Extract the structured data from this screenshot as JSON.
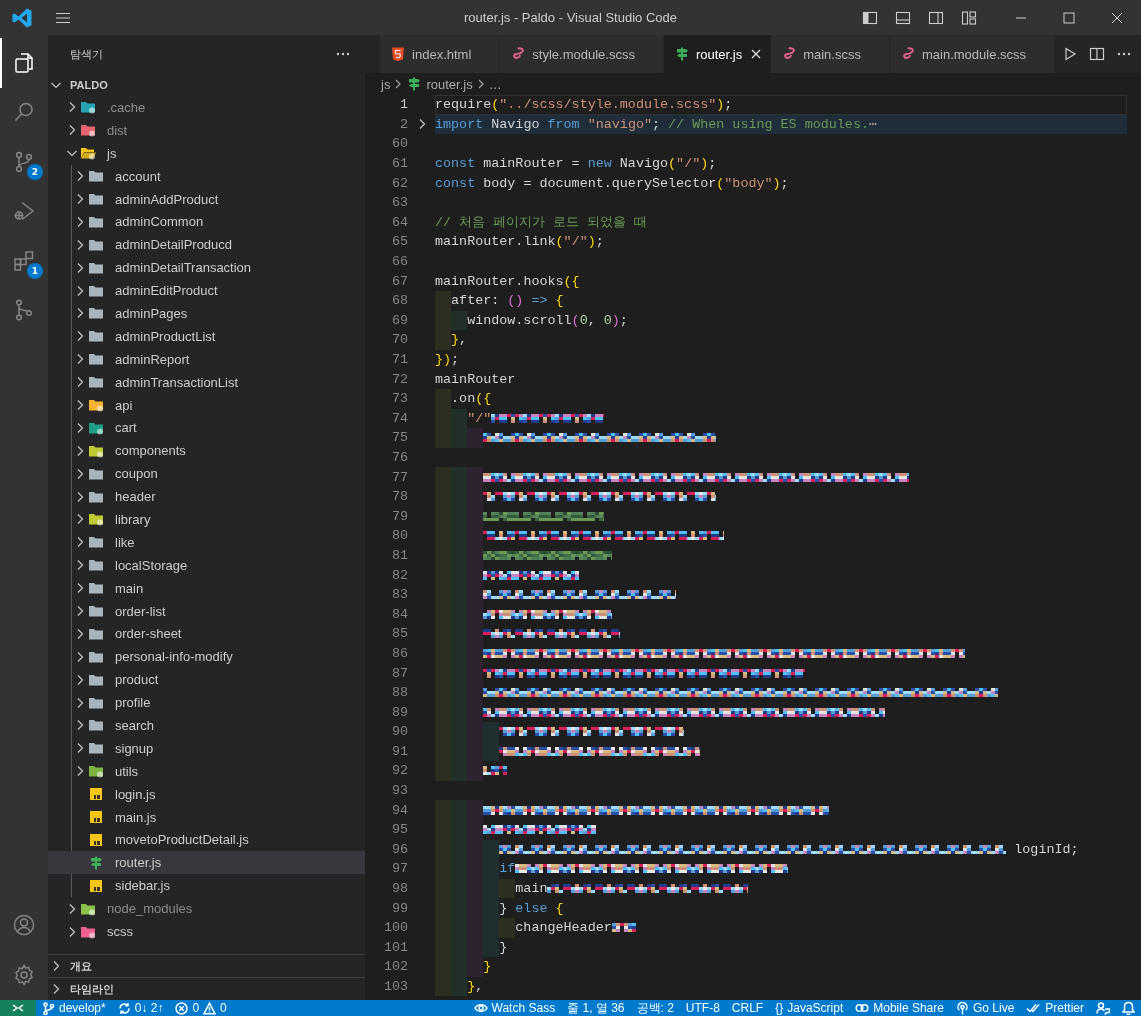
{
  "window": {
    "title": "router.js - Paldo - Visual Studio Code"
  },
  "activity_bar": {
    "items": [
      {
        "kind": "explorer",
        "selected": true
      },
      {
        "kind": "search",
        "selected": false
      },
      {
        "kind": "source-control",
        "selected": false,
        "badge": "2"
      },
      {
        "kind": "run-debug",
        "selected": false
      },
      {
        "kind": "extensions",
        "selected": false,
        "badge": "1"
      },
      {
        "kind": "git-graph",
        "selected": false
      }
    ],
    "bottom": [
      {
        "kind": "accounts"
      },
      {
        "kind": "settings"
      }
    ]
  },
  "sidebar": {
    "title": "탐색기",
    "root": {
      "label": "PALDO",
      "expanded": true
    },
    "tree": [
      {
        "label": ".cache",
        "kind": "cache-folder",
        "expanded": false,
        "ignored": true,
        "selected": false
      },
      {
        "label": "dist",
        "kind": "dist-folder",
        "expanded": false,
        "ignored": true,
        "selected": false
      },
      {
        "label": "js",
        "kind": "js-folder",
        "expanded": true,
        "ignored": false,
        "selected": false,
        "children": [
          {
            "label": "account",
            "kind": "folder",
            "expanded": false,
            "ignored": false,
            "selected": false
          },
          {
            "label": "adminAddProduct",
            "kind": "folder",
            "expanded": false,
            "ignored": false,
            "selected": false
          },
          {
            "label": "adminCommon",
            "kind": "folder",
            "expanded": false,
            "ignored": false,
            "selected": false
          },
          {
            "label": "adminDetailProducd",
            "kind": "folder",
            "expanded": false,
            "ignored": false,
            "selected": false
          },
          {
            "label": "adminDetailTransaction",
            "kind": "folder",
            "expanded": false,
            "ignored": false,
            "selected": false
          },
          {
            "label": "adminEditProduct",
            "kind": "folder",
            "expanded": false,
            "ignored": false,
            "selected": false
          },
          {
            "label": "adminPages",
            "kind": "folder",
            "expanded": false,
            "ignored": false,
            "selected": false
          },
          {
            "label": "adminProductList",
            "kind": "folder",
            "expanded": false,
            "ignored": false,
            "selected": false
          },
          {
            "label": "adminReport",
            "kind": "folder",
            "expanded": false,
            "ignored": false,
            "selected": false
          },
          {
            "label": "adminTransactionList",
            "kind": "folder",
            "expanded": false,
            "ignored": false,
            "selected": false
          },
          {
            "label": "api",
            "kind": "api-folder",
            "expanded": false,
            "ignored": false,
            "selected": false
          },
          {
            "label": "cart",
            "kind": "cart-folder",
            "expanded": false,
            "ignored": false,
            "selected": false
          },
          {
            "label": "components",
            "kind": "components-folder",
            "expanded": false,
            "ignored": false,
            "selected": false
          },
          {
            "label": "coupon",
            "kind": "folder",
            "expanded": false,
            "ignored": false,
            "selected": false
          },
          {
            "label": "header",
            "kind": "folder",
            "expanded": false,
            "ignored": false,
            "selected": false
          },
          {
            "label": "library",
            "kind": "library-folder",
            "expanded": false,
            "ignored": false,
            "selected": false
          },
          {
            "label": "like",
            "kind": "folder",
            "expanded": false,
            "ignored": false,
            "selected": false
          },
          {
            "label": "localStorage",
            "kind": "folder",
            "expanded": false,
            "ignored": false,
            "selected": false
          },
          {
            "label": "main",
            "kind": "folder",
            "expanded": false,
            "ignored": false,
            "selected": false
          },
          {
            "label": "order-list",
            "kind": "folder",
            "expanded": false,
            "ignored": false,
            "selected": false
          },
          {
            "label": "order-sheet",
            "kind": "folder",
            "expanded": false,
            "ignored": false,
            "selected": false
          },
          {
            "label": "personal-info-modify",
            "kind": "folder",
            "expanded": false,
            "ignored": false,
            "selected": false
          },
          {
            "label": "product",
            "kind": "folder",
            "expanded": false,
            "ignored": false,
            "selected": false
          },
          {
            "label": "profile",
            "kind": "folder",
            "expanded": false,
            "ignored": false,
            "selected": false
          },
          {
            "label": "search",
            "kind": "folder",
            "expanded": false,
            "ignored": false,
            "selected": false
          },
          {
            "label": "signup",
            "kind": "folder",
            "expanded": false,
            "ignored": false,
            "selected": false
          },
          {
            "label": "utils",
            "kind": "utils-folder",
            "expanded": false,
            "ignored": false,
            "selected": false
          },
          {
            "label": "login.js",
            "kind": "js-file",
            "ignored": false,
            "selected": false
          },
          {
            "label": "main.js",
            "kind": "js-file",
            "ignored": false,
            "selected": false
          },
          {
            "label": "movetoProductDetail.js",
            "kind": "js-file",
            "ignored": false,
            "selected": false
          },
          {
            "label": "router.js",
            "kind": "router-file",
            "ignored": false,
            "selected": true
          },
          {
            "label": "sidebar.js",
            "kind": "js-file",
            "ignored": false,
            "selected": false
          }
        ]
      },
      {
        "label": "node_modules",
        "kind": "node-folder",
        "expanded": false,
        "ignored": true,
        "selected": false
      },
      {
        "label": "scss",
        "kind": "sass-folder",
        "expanded": false,
        "ignored": false,
        "selected": false
      }
    ],
    "sections": [
      {
        "label": "개요",
        "expanded": false
      },
      {
        "label": "타임라인",
        "expanded": false
      }
    ]
  },
  "editor": {
    "tabs": [
      {
        "label": "index.html",
        "kind": "html-file",
        "selected": false
      },
      {
        "label": "style.module.scss",
        "kind": "sass-file",
        "selected": false
      },
      {
        "label": "router.js",
        "kind": "router-file",
        "selected": true
      },
      {
        "label": "main.scss",
        "kind": "sass-file",
        "selected": false
      },
      {
        "label": "main.module.scss",
        "kind": "sass-file",
        "selected": false
      }
    ],
    "breadcrumbs": [
      {
        "label": "js",
        "kind": "folder"
      },
      {
        "label": "router.js",
        "kind": "router-file"
      },
      {
        "label": "…",
        "kind": "symbol"
      }
    ],
    "lines": [
      {
        "number": "1",
        "kind": "code",
        "current": true,
        "tokens": [
          {
            "text": "require",
            "kind": "plain"
          },
          {
            "text": "(",
            "kind": "bracket1"
          },
          {
            "text": "\"../scss/style.module.scss\"",
            "kind": "string"
          },
          {
            "text": ")",
            "kind": "bracket1"
          },
          {
            "text": ";",
            "kind": "plain"
          }
        ]
      },
      {
        "number": "2",
        "kind": "folded",
        "current": false,
        "tokens": [
          {
            "text": "import",
            "kind": "keyword"
          },
          {
            "text": " Navigo ",
            "kind": "plain"
          },
          {
            "text": "from",
            "kind": "keyword"
          },
          {
            "text": " \"navigo\"",
            "kind": "string"
          },
          {
            "text": "; ",
            "kind": "plain"
          },
          {
            "text": "// When using ES modules.",
            "kind": "comment"
          },
          {
            "text": "⋯",
            "kind": "ellipsis"
          }
        ]
      },
      {
        "number": "60",
        "kind": "blank",
        "current": false
      },
      {
        "number": "61",
        "kind": "code",
        "current": false,
        "tokens": [
          {
            "text": "const",
            "kind": "keyword"
          },
          {
            "text": " mainRouter = ",
            "kind": "plain"
          },
          {
            "text": "new",
            "kind": "keyword"
          },
          {
            "text": " Navigo",
            "kind": "plain"
          },
          {
            "text": "(",
            "kind": "bracket1"
          },
          {
            "text": "\"/\"",
            "kind": "string"
          },
          {
            "text": ")",
            "kind": "bracket1"
          },
          {
            "text": ";",
            "kind": "plain"
          }
        ]
      },
      {
        "number": "62",
        "kind": "code",
        "current": false,
        "tokens": [
          {
            "text": "const",
            "kind": "keyword"
          },
          {
            "text": " body = document.querySelector",
            "kind": "plain"
          },
          {
            "text": "(",
            "kind": "bracket1"
          },
          {
            "text": "\"body\"",
            "kind": "string"
          },
          {
            "text": ")",
            "kind": "bracket1"
          },
          {
            "text": ";",
            "kind": "plain"
          }
        ]
      },
      {
        "number": "63",
        "kind": "blank",
        "current": false
      },
      {
        "number": "64",
        "kind": "code",
        "current": false,
        "tokens": [
          {
            "text": "// 처음 페이지가 로드 되었을 때",
            "kind": "comment"
          }
        ]
      },
      {
        "number": "65",
        "kind": "code",
        "current": false,
        "tokens": [
          {
            "text": "mainRouter.link",
            "kind": "plain"
          },
          {
            "text": "(",
            "kind": "bracket1"
          },
          {
            "text": "\"/\"",
            "kind": "string"
          },
          {
            "text": ")",
            "kind": "bracket1"
          },
          {
            "text": ";",
            "kind": "plain"
          }
        ]
      },
      {
        "number": "66",
        "kind": "blank",
        "current": false
      },
      {
        "number": "67",
        "kind": "code",
        "current": false,
        "tokens": [
          {
            "text": "mainRouter.hooks",
            "kind": "plain"
          },
          {
            "text": "({",
            "kind": "bracket1"
          }
        ]
      },
      {
        "number": "68",
        "kind": "code",
        "current": false,
        "tokens": [
          {
            "text": "  after: ",
            "kind": "plain"
          },
          {
            "text": "()",
            "kind": "bracket2"
          },
          {
            "text": " =>",
            "kind": "keyword"
          },
          {
            "text": " {",
            "kind": "bracket1"
          }
        ]
      },
      {
        "number": "69",
        "kind": "code",
        "current": false,
        "tokens": [
          {
            "text": "    window.scroll",
            "kind": "plain"
          },
          {
            "text": "(",
            "kind": "bracket2"
          },
          {
            "text": "0",
            "kind": "number"
          },
          {
            "text": ", ",
            "kind": "plain"
          },
          {
            "text": "0",
            "kind": "number"
          },
          {
            "text": ")",
            "kind": "bracket2"
          },
          {
            "text": ";",
            "kind": "plain"
          }
        ]
      },
      {
        "number": "70",
        "kind": "code",
        "current": false,
        "tokens": [
          {
            "text": "  }",
            "kind": "bracket1"
          },
          {
            "text": ",",
            "kind": "plain"
          }
        ]
      },
      {
        "number": "71",
        "kind": "code",
        "current": false,
        "tokens": [
          {
            "text": "})",
            "kind": "bracket1"
          },
          {
            "text": ";",
            "kind": "plain"
          }
        ]
      },
      {
        "number": "72",
        "kind": "code",
        "current": false,
        "tokens": [
          {
            "text": "mainRouter",
            "kind": "plain"
          }
        ]
      },
      {
        "number": "73",
        "kind": "code",
        "current": false,
        "tokens": [
          {
            "text": "  .on",
            "kind": "plain"
          },
          {
            "text": "({",
            "kind": "bracket1"
          }
        ]
      },
      {
        "number": "74",
        "kind": "code",
        "current": false,
        "tokens": [
          {
            "text": "    \"/\"",
            "kind": "string"
          },
          {
            "kind": "pixelated"
          }
        ]
      },
      {
        "number": "75",
        "kind": "code",
        "current": false,
        "tokens": [
          {
            "kind": "pixelated"
          }
        ]
      },
      {
        "number": "76",
        "kind": "blank",
        "current": false
      },
      {
        "number": "77",
        "kind": "code",
        "current": false,
        "tokens": [
          {
            "kind": "pixelated"
          }
        ]
      },
      {
        "number": "78",
        "kind": "code",
        "current": false,
        "tokens": [
          {
            "kind": "pixelated"
          }
        ]
      },
      {
        "number": "79",
        "kind": "code",
        "current": false,
        "tokens": [
          {
            "kind": "pixelated-comment"
          }
        ]
      },
      {
        "number": "80",
        "kind": "code",
        "current": false,
        "tokens": [
          {
            "kind": "pixelated"
          }
        ]
      },
      {
        "number": "81",
        "kind": "code",
        "current": false,
        "tokens": [
          {
            "kind": "pixelated-comment"
          }
        ]
      },
      {
        "number": "82",
        "kind": "code",
        "current": false,
        "tokens": [
          {
            "kind": "pixelated"
          }
        ]
      },
      {
        "number": "83",
        "kind": "code",
        "current": false,
        "tokens": [
          {
            "kind": "pixelated"
          }
        ]
      },
      {
        "number": "84",
        "kind": "code",
        "current": false,
        "tokens": [
          {
            "kind": "pixelated"
          }
        ]
      },
      {
        "number": "85",
        "kind": "code",
        "current": false,
        "tokens": [
          {
            "kind": "pixelated"
          }
        ]
      },
      {
        "number": "86",
        "kind": "code",
        "current": false,
        "tokens": [
          {
            "kind": "pixelated"
          }
        ]
      },
      {
        "number": "87",
        "kind": "code",
        "current": false,
        "tokens": [
          {
            "kind": "pixelated"
          }
        ]
      },
      {
        "number": "88",
        "kind": "code",
        "current": false,
        "tokens": [
          {
            "kind": "pixelated"
          }
        ]
      },
      {
        "number": "89",
        "kind": "code",
        "current": false,
        "tokens": [
          {
            "kind": "pixelated"
          }
        ]
      },
      {
        "number": "90",
        "kind": "code",
        "current": false,
        "tokens": [
          {
            "kind": "pixelated"
          }
        ]
      },
      {
        "number": "91",
        "kind": "code",
        "current": false,
        "tokens": [
          {
            "kind": "pixelated"
          }
        ]
      },
      {
        "number": "92",
        "kind": "code",
        "current": false,
        "tokens": [
          {
            "kind": "pixelated"
          }
        ]
      },
      {
        "number": "93",
        "kind": "blank",
        "current": false
      },
      {
        "number": "94",
        "kind": "code",
        "current": false,
        "tokens": [
          {
            "kind": "pixelated"
          }
        ]
      },
      {
        "number": "95",
        "kind": "code",
        "current": false,
        "tokens": [
          {
            "kind": "pixelated"
          }
        ]
      },
      {
        "number": "96",
        "kind": "code",
        "current": false,
        "tokens": [
          {
            "kind": "pixelated"
          },
          {
            "text": " loginId;",
            "kind": "plain"
          }
        ]
      },
      {
        "number": "97",
        "kind": "code",
        "current": false,
        "tokens": [
          {
            "text": "        if",
            "kind": "keyword"
          },
          {
            "kind": "pixelated"
          }
        ]
      },
      {
        "number": "98",
        "kind": "code",
        "current": false,
        "tokens": [
          {
            "text": "          main",
            "kind": "plain"
          },
          {
            "kind": "pixelated"
          }
        ]
      },
      {
        "number": "99",
        "kind": "code",
        "current": false,
        "tokens": [
          {
            "text": "        } ",
            "kind": "plain"
          },
          {
            "text": "else",
            "kind": "keyword"
          },
          {
            "text": " {",
            "kind": "bracket1"
          }
        ]
      },
      {
        "number": "100",
        "kind": "code",
        "current": false,
        "tokens": [
          {
            "text": "          changeHeader",
            "kind": "plain"
          },
          {
            "kind": "pixelated"
          }
        ]
      },
      {
        "number": "101",
        "kind": "code",
        "current": false,
        "tokens": [
          {
            "text": "        }",
            "kind": "plain"
          }
        ]
      },
      {
        "number": "102",
        "kind": "code",
        "current": false,
        "tokens": [
          {
            "text": "      }",
            "kind": "bracket1"
          }
        ]
      },
      {
        "number": "103",
        "kind": "code",
        "current": false,
        "tokens": [
          {
            "text": "    }",
            "kind": "bracket1"
          },
          {
            "text": ",",
            "kind": "plain"
          }
        ]
      }
    ]
  },
  "status_bar": {
    "left": [
      {
        "kind": "remote"
      },
      {
        "kind": "branch",
        "text": "develop*"
      },
      {
        "kind": "sync",
        "text": "0↓ 2↑"
      },
      {
        "kind": "problems",
        "errors": "0",
        "warnings": "0"
      }
    ],
    "right": [
      {
        "kind": "watch",
        "text": "Watch Sass"
      },
      {
        "kind": "plain",
        "text": "줄 1, 열 36"
      },
      {
        "kind": "plain",
        "text": "공백: 2"
      },
      {
        "kind": "plain",
        "text": "UTF-8"
      },
      {
        "kind": "plain",
        "text": "CRLF"
      },
      {
        "kind": "language",
        "glyph": "{}",
        "text": "JavaScript"
      },
      {
        "kind": "share",
        "text": "Mobile Share"
      },
      {
        "kind": "live",
        "text": "Go Live"
      },
      {
        "kind": "prettier",
        "text": "Prettier"
      },
      {
        "kind": "feedback"
      },
      {
        "kind": "bell"
      }
    ]
  }
}
